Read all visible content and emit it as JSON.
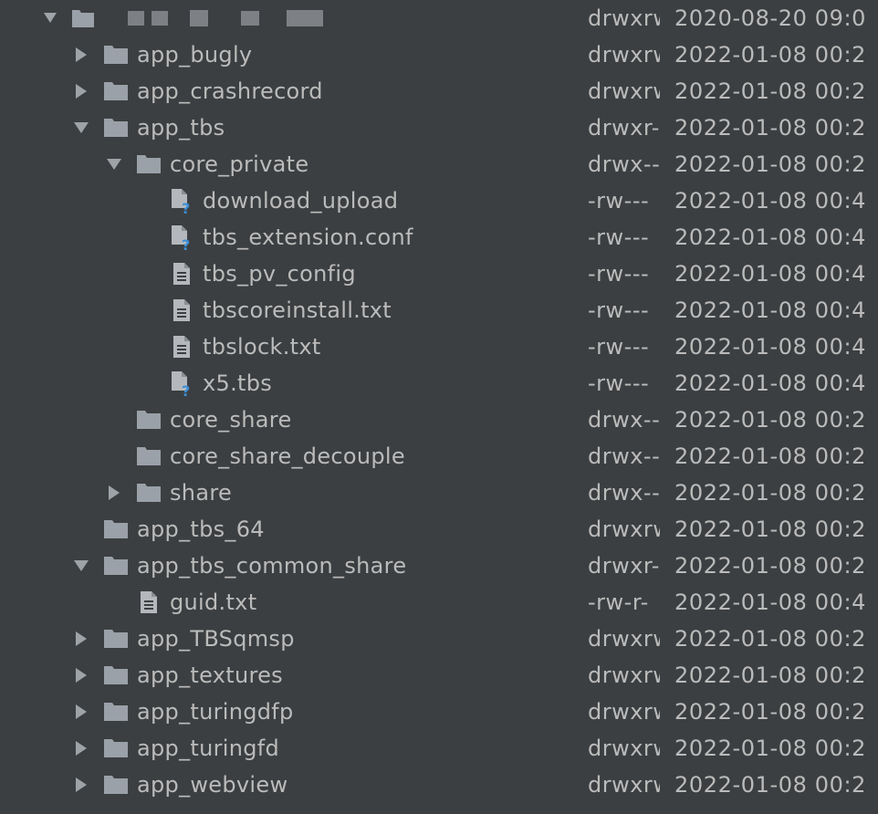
{
  "colors": {
    "background": "#3c3f41",
    "text": "#bbbbbb",
    "folder": "#9aa1a8",
    "file": "#b4b8bc",
    "unknown_badge": "#3d8fd8",
    "chevron": "#9ea3a8"
  },
  "header": {
    "root_perm": "drwxrw",
    "root_date": "2020-08-20 09:0"
  },
  "rows": [
    {
      "name": "app_bugly",
      "perm": "drwxrw",
      "date": "2022-01-08 00:2",
      "icon": "folder-icon",
      "chevron": "collapsed"
    },
    {
      "name": "app_crashrecord",
      "perm": "drwxrw",
      "date": "2022-01-08 00:2",
      "icon": "folder-icon",
      "chevron": "collapsed"
    },
    {
      "name": "app_tbs",
      "perm": "drwxr-",
      "date": "2022-01-08 00:2",
      "icon": "folder-icon",
      "chevron": "expanded"
    },
    {
      "name": "core_private",
      "perm": "drwx--",
      "date": "2022-01-08 00:2",
      "icon": "folder-icon",
      "chevron": "expanded"
    },
    {
      "name": "download_upload",
      "perm": "-rw---",
      "date": "2022-01-08 00:4",
      "icon": "unknown-file-icon",
      "chevron": "none"
    },
    {
      "name": "tbs_extension.conf",
      "perm": "-rw---",
      "date": "2022-01-08 00:4",
      "icon": "unknown-file-icon",
      "chevron": "none"
    },
    {
      "name": "tbs_pv_config",
      "perm": "-rw---",
      "date": "2022-01-08 00:4",
      "icon": "text-file-icon",
      "chevron": "none"
    },
    {
      "name": "tbscoreinstall.txt",
      "perm": "-rw---",
      "date": "2022-01-08 00:4",
      "icon": "text-file-icon",
      "chevron": "none"
    },
    {
      "name": "tbslock.txt",
      "perm": "-rw---",
      "date": "2022-01-08 00:4",
      "icon": "text-file-icon",
      "chevron": "none"
    },
    {
      "name": "x5.tbs",
      "perm": "-rw---",
      "date": "2022-01-08 00:4",
      "icon": "unknown-file-icon",
      "chevron": "none"
    },
    {
      "name": "core_share",
      "perm": "drwx--",
      "date": "2022-01-08 00:2",
      "icon": "folder-icon",
      "chevron": "none"
    },
    {
      "name": "core_share_decouple",
      "perm": "drwx--",
      "date": "2022-01-08 00:2",
      "icon": "folder-icon",
      "chevron": "none"
    },
    {
      "name": "share",
      "perm": "drwx--",
      "date": "2022-01-08 00:2",
      "icon": "folder-icon",
      "chevron": "collapsed"
    },
    {
      "name": "app_tbs_64",
      "perm": "drwxrw",
      "date": "2022-01-08 00:2",
      "icon": "folder-icon",
      "chevron": "none"
    },
    {
      "name": "app_tbs_common_share",
      "perm": "drwxr-",
      "date": "2022-01-08 00:2",
      "icon": "folder-icon",
      "chevron": "expanded"
    },
    {
      "name": "guid.txt",
      "perm": "-rw-r-",
      "date": "2022-01-08 00:4",
      "icon": "text-file-icon",
      "chevron": "none"
    },
    {
      "name": "app_TBSqmsp",
      "perm": "drwxrw",
      "date": "2022-01-08 00:2",
      "icon": "folder-icon",
      "chevron": "collapsed"
    },
    {
      "name": "app_textures",
      "perm": "drwxrw",
      "date": "2022-01-08 00:2",
      "icon": "folder-icon",
      "chevron": "collapsed"
    },
    {
      "name": "app_turingdfp",
      "perm": "drwxrw",
      "date": "2022-01-08 00:2",
      "icon": "folder-icon",
      "chevron": "collapsed"
    },
    {
      "name": "app_turingfd",
      "perm": "drwxrw",
      "date": "2022-01-08 00:2",
      "icon": "folder-icon",
      "chevron": "collapsed"
    },
    {
      "name": "app_webview",
      "perm": "drwxrw",
      "date": "2022-01-08 00:2",
      "icon": "folder-icon",
      "chevron": "collapsed"
    }
  ]
}
